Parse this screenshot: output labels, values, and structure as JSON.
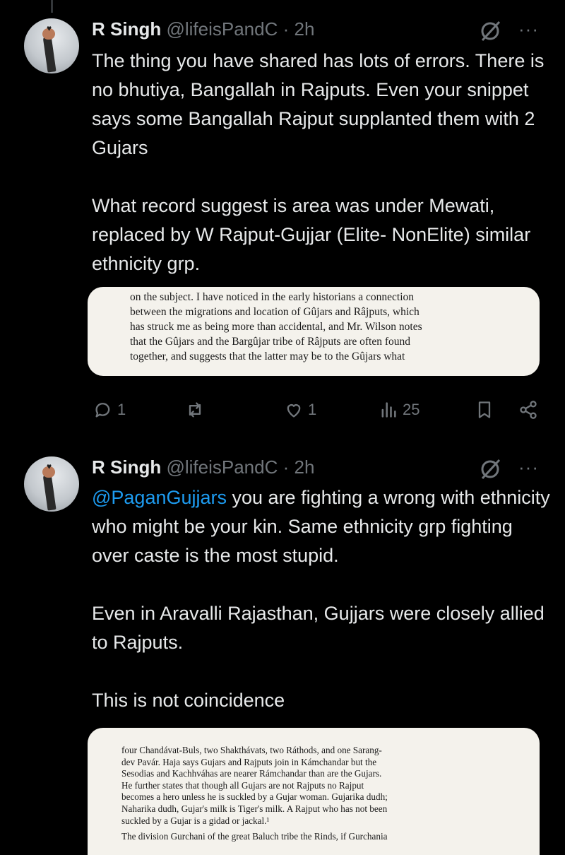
{
  "tweets": [
    {
      "author_name": "R Singh",
      "author_handle": "@lifeisPandC",
      "separator": "·",
      "time": "2h",
      "more": "···",
      "paragraphs": [
        "The thing you have shared has lots of errors. There is no bhutiya, Bangallah in Rajputs. Even your snippet says some Bangallah Rajput supplanted them with 2 Gujars",
        "What record suggest is area was under Mewati, replaced by W Rajput-Gujjar (Elite- NonElite) similar ethnicity grp."
      ],
      "media_lines": [
        "on the subject. I have noticed in the early historians a connection",
        "between the migrations and location of Gûjars and Râjputs, which",
        "has struck me as being more than accidental, and Mr. Wilson notes",
        "that the Gûjars and the Bargûjar tribe of Râjputs are often found",
        "together, and suggests that the latter may be to the Gûjars what"
      ],
      "actions": {
        "replies": "1",
        "reposts": "",
        "likes": "1",
        "views": "25"
      }
    },
    {
      "author_name": "R Singh",
      "author_handle": "@lifeisPandC",
      "separator": "·",
      "time": "2h",
      "more": "···",
      "mention": "@PaganGujjars",
      "paragraph1_rest": " you are fighting a wrong with ethnicity who might be your kin. Same ethnicity grp fighting over caste is the most stupid.",
      "paragraph2": "Even in Aravalli Rajasthan, Gujjars were closely allied to Rajputs.",
      "paragraph3": "This is not coincidence",
      "media_lines": [
        "four Chandávat-Buls, two Shakthávats, two Ráthods, and one Sarang-",
        "dev Pavár. Haja says Gujars and Rajputs join in Kámchandar but the",
        "Sesodias and Kachhváhas are nearer Rámchandar than are the Gujars.",
        "He further states that though all Gujars are not Rajputs no Rajput",
        "becomes a hero unless he is suckled by a Gujar woman. Gujarika dudh;",
        "Naharika dudh, Gujar's milk is Tiger's milk. A Rajput who has not been",
        "suckled by a Gujar is a gidad or jackal.¹",
        "The division Gurchani of the great Baluch tribe the Rinds, if Gurchania"
      ]
    }
  ],
  "colors": {
    "background": "#000000",
    "text": "#e7e9ea",
    "muted": "#71767b",
    "link": "#1d9bf0"
  },
  "icons": [
    "reply-icon",
    "repost-icon",
    "like-icon",
    "views-icon",
    "bookmark-icon",
    "share-icon",
    "grok-icon",
    "more-icon"
  ]
}
